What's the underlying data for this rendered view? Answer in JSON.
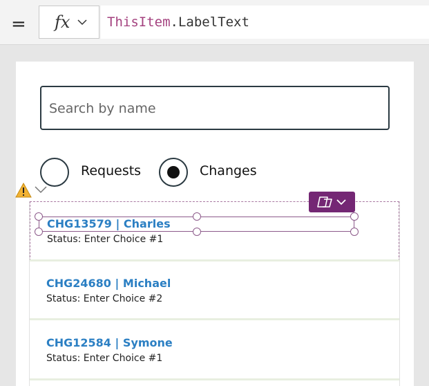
{
  "formula_bar": {
    "equals": "=",
    "fx_label": "fx",
    "formula_ident": "ThisItem",
    "formula_rest": ".LabelText"
  },
  "screen": {
    "search": {
      "placeholder": "Search by name"
    },
    "radio_options": [
      {
        "label": "Requests",
        "selected": false
      },
      {
        "label": "Changes",
        "selected": true
      }
    ],
    "gallery": {
      "items": [
        {
          "title": "CHG13579 | Charles",
          "status": "Status: Enter Choice #1"
        },
        {
          "title": "CHG24680 | Michael",
          "status": "Status: Enter Choice #2"
        },
        {
          "title": "CHG12584 | Symone",
          "status": "Status: Enter Choice #1"
        }
      ]
    }
  },
  "colors": {
    "title_link": "#2b7fc3",
    "formula_ident": "#a4427f",
    "copilot_accent": "#742774",
    "selection": "#8c5a8a",
    "warning": "#f2b233"
  }
}
